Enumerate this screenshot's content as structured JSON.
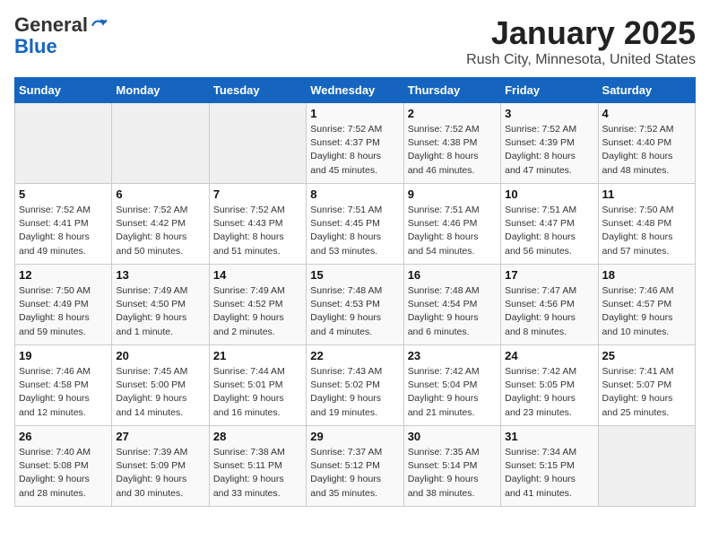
{
  "header": {
    "logo_line1": "General",
    "logo_line2": "Blue",
    "month": "January 2025",
    "location": "Rush City, Minnesota, United States"
  },
  "weekdays": [
    "Sunday",
    "Monday",
    "Tuesday",
    "Wednesday",
    "Thursday",
    "Friday",
    "Saturday"
  ],
  "weeks": [
    [
      {
        "day": "",
        "detail": ""
      },
      {
        "day": "",
        "detail": ""
      },
      {
        "day": "",
        "detail": ""
      },
      {
        "day": "1",
        "detail": "Sunrise: 7:52 AM\nSunset: 4:37 PM\nDaylight: 8 hours\nand 45 minutes."
      },
      {
        "day": "2",
        "detail": "Sunrise: 7:52 AM\nSunset: 4:38 PM\nDaylight: 8 hours\nand 46 minutes."
      },
      {
        "day": "3",
        "detail": "Sunrise: 7:52 AM\nSunset: 4:39 PM\nDaylight: 8 hours\nand 47 minutes."
      },
      {
        "day": "4",
        "detail": "Sunrise: 7:52 AM\nSunset: 4:40 PM\nDaylight: 8 hours\nand 48 minutes."
      }
    ],
    [
      {
        "day": "5",
        "detail": "Sunrise: 7:52 AM\nSunset: 4:41 PM\nDaylight: 8 hours\nand 49 minutes."
      },
      {
        "day": "6",
        "detail": "Sunrise: 7:52 AM\nSunset: 4:42 PM\nDaylight: 8 hours\nand 50 minutes."
      },
      {
        "day": "7",
        "detail": "Sunrise: 7:52 AM\nSunset: 4:43 PM\nDaylight: 8 hours\nand 51 minutes."
      },
      {
        "day": "8",
        "detail": "Sunrise: 7:51 AM\nSunset: 4:45 PM\nDaylight: 8 hours\nand 53 minutes."
      },
      {
        "day": "9",
        "detail": "Sunrise: 7:51 AM\nSunset: 4:46 PM\nDaylight: 8 hours\nand 54 minutes."
      },
      {
        "day": "10",
        "detail": "Sunrise: 7:51 AM\nSunset: 4:47 PM\nDaylight: 8 hours\nand 56 minutes."
      },
      {
        "day": "11",
        "detail": "Sunrise: 7:50 AM\nSunset: 4:48 PM\nDaylight: 8 hours\nand 57 minutes."
      }
    ],
    [
      {
        "day": "12",
        "detail": "Sunrise: 7:50 AM\nSunset: 4:49 PM\nDaylight: 8 hours\nand 59 minutes."
      },
      {
        "day": "13",
        "detail": "Sunrise: 7:49 AM\nSunset: 4:50 PM\nDaylight: 9 hours\nand 1 minute."
      },
      {
        "day": "14",
        "detail": "Sunrise: 7:49 AM\nSunset: 4:52 PM\nDaylight: 9 hours\nand 2 minutes."
      },
      {
        "day": "15",
        "detail": "Sunrise: 7:48 AM\nSunset: 4:53 PM\nDaylight: 9 hours\nand 4 minutes."
      },
      {
        "day": "16",
        "detail": "Sunrise: 7:48 AM\nSunset: 4:54 PM\nDaylight: 9 hours\nand 6 minutes."
      },
      {
        "day": "17",
        "detail": "Sunrise: 7:47 AM\nSunset: 4:56 PM\nDaylight: 9 hours\nand 8 minutes."
      },
      {
        "day": "18",
        "detail": "Sunrise: 7:46 AM\nSunset: 4:57 PM\nDaylight: 9 hours\nand 10 minutes."
      }
    ],
    [
      {
        "day": "19",
        "detail": "Sunrise: 7:46 AM\nSunset: 4:58 PM\nDaylight: 9 hours\nand 12 minutes."
      },
      {
        "day": "20",
        "detail": "Sunrise: 7:45 AM\nSunset: 5:00 PM\nDaylight: 9 hours\nand 14 minutes."
      },
      {
        "day": "21",
        "detail": "Sunrise: 7:44 AM\nSunset: 5:01 PM\nDaylight: 9 hours\nand 16 minutes."
      },
      {
        "day": "22",
        "detail": "Sunrise: 7:43 AM\nSunset: 5:02 PM\nDaylight: 9 hours\nand 19 minutes."
      },
      {
        "day": "23",
        "detail": "Sunrise: 7:42 AM\nSunset: 5:04 PM\nDaylight: 9 hours\nand 21 minutes."
      },
      {
        "day": "24",
        "detail": "Sunrise: 7:42 AM\nSunset: 5:05 PM\nDaylight: 9 hours\nand 23 minutes."
      },
      {
        "day": "25",
        "detail": "Sunrise: 7:41 AM\nSunset: 5:07 PM\nDaylight: 9 hours\nand 25 minutes."
      }
    ],
    [
      {
        "day": "26",
        "detail": "Sunrise: 7:40 AM\nSunset: 5:08 PM\nDaylight: 9 hours\nand 28 minutes."
      },
      {
        "day": "27",
        "detail": "Sunrise: 7:39 AM\nSunset: 5:09 PM\nDaylight: 9 hours\nand 30 minutes."
      },
      {
        "day": "28",
        "detail": "Sunrise: 7:38 AM\nSunset: 5:11 PM\nDaylight: 9 hours\nand 33 minutes."
      },
      {
        "day": "29",
        "detail": "Sunrise: 7:37 AM\nSunset: 5:12 PM\nDaylight: 9 hours\nand 35 minutes."
      },
      {
        "day": "30",
        "detail": "Sunrise: 7:35 AM\nSunset: 5:14 PM\nDaylight: 9 hours\nand 38 minutes."
      },
      {
        "day": "31",
        "detail": "Sunrise: 7:34 AM\nSunset: 5:15 PM\nDaylight: 9 hours\nand 41 minutes."
      },
      {
        "day": "",
        "detail": ""
      }
    ]
  ]
}
